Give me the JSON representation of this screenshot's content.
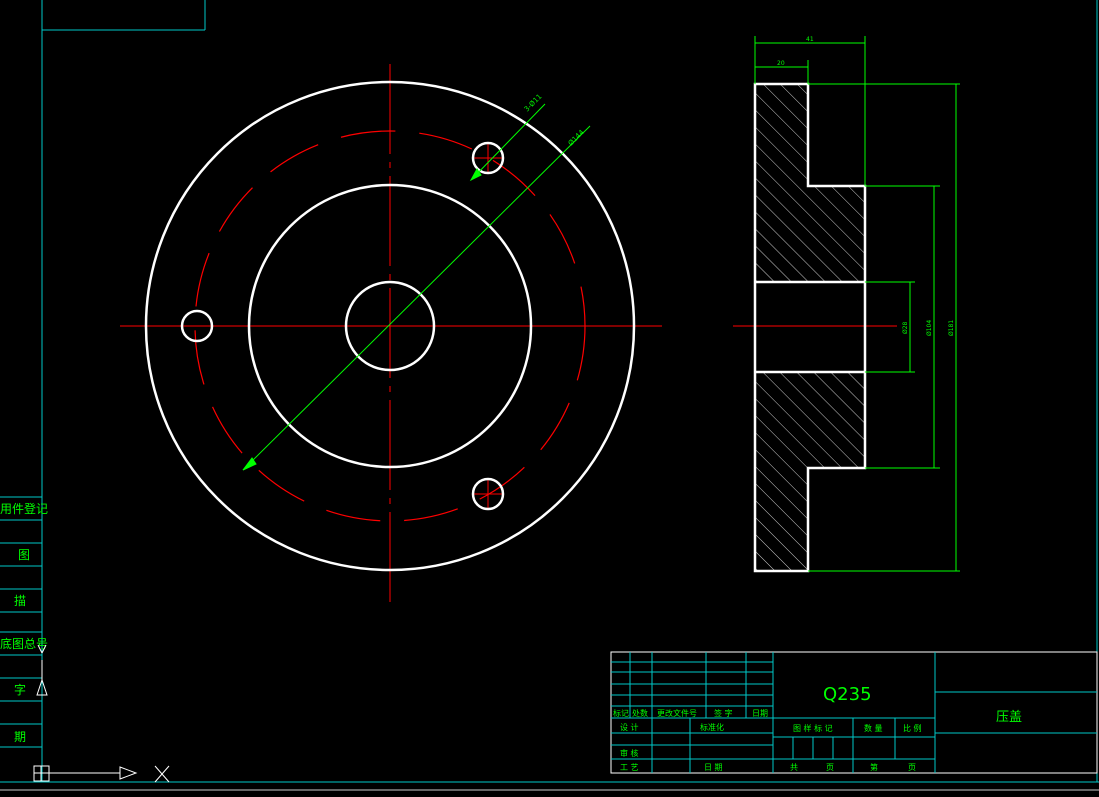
{
  "colors": {
    "background": "#000000",
    "outline": "#ffffff",
    "centerline": "#ff0000",
    "dimension": "#00ff00",
    "frame": "#00c8c8",
    "title_text": "#00ff00"
  },
  "left_panel": {
    "labels": [
      "用件登记",
      "图",
      "描",
      "底图总号",
      "字",
      "期"
    ],
    "partial_labels": [
      "用件登记",
      "图",
      "描",
      "底图总号",
      "字",
      "期"
    ]
  },
  "front_view": {
    "pcd_callout": "Ø144",
    "hole_callout": "3-Ø11"
  },
  "side_view": {
    "dimensions": {
      "total_width": "41",
      "flange_width": "20",
      "bore_dia": "Ø28",
      "hub_dia": "Ø104",
      "outer_dia": "Ø181"
    }
  },
  "title_block": {
    "material": "Q235",
    "part_name": "压盖",
    "rev_headers": [
      "标记",
      "处数",
      "更改文件号",
      "签 字",
      "日期"
    ],
    "left_rows": [
      "设 计",
      "审 核",
      "工 艺"
    ],
    "standardization": "标准化",
    "date_label": "日 期",
    "stage_headers": [
      "图 样 标 记",
      "数 量",
      "比 例"
    ],
    "sheet_labels": [
      "共",
      "页",
      "第",
      "页"
    ]
  }
}
